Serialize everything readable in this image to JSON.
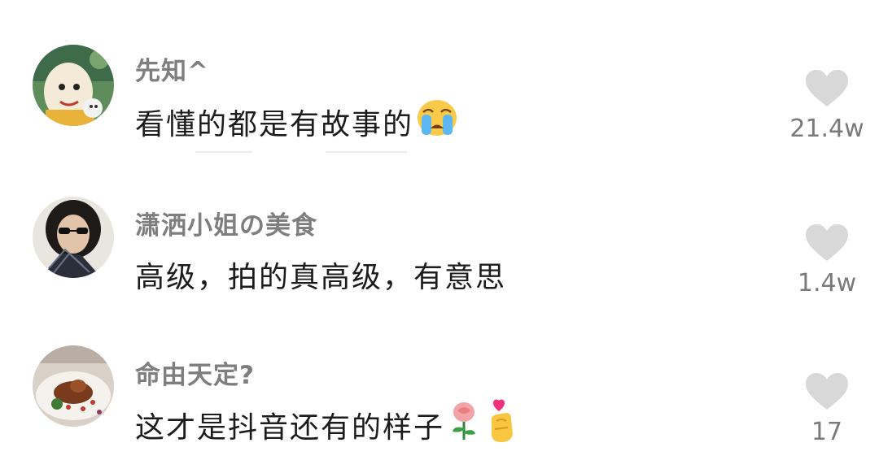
{
  "comments": [
    {
      "username": "先知^",
      "text": "看懂的都是有故事的",
      "emoji_icon": "crying-face-icon",
      "likes": "21.4w"
    },
    {
      "username": "潇洒小姐の美食",
      "text": "高级，拍的真高级，有意思",
      "emoji_icon": "",
      "likes": "1.4w"
    },
    {
      "username": "命由天定?",
      "text": "这才是抖音还有的样子",
      "emoji_icon": "rose-icon finger-heart-icon",
      "likes": "17"
    }
  ],
  "colors": {
    "username": "#7e7e7e",
    "comment_text": "#1c1c1c",
    "heart": "#d8d8d8",
    "like_count": "#7a7a7a"
  }
}
